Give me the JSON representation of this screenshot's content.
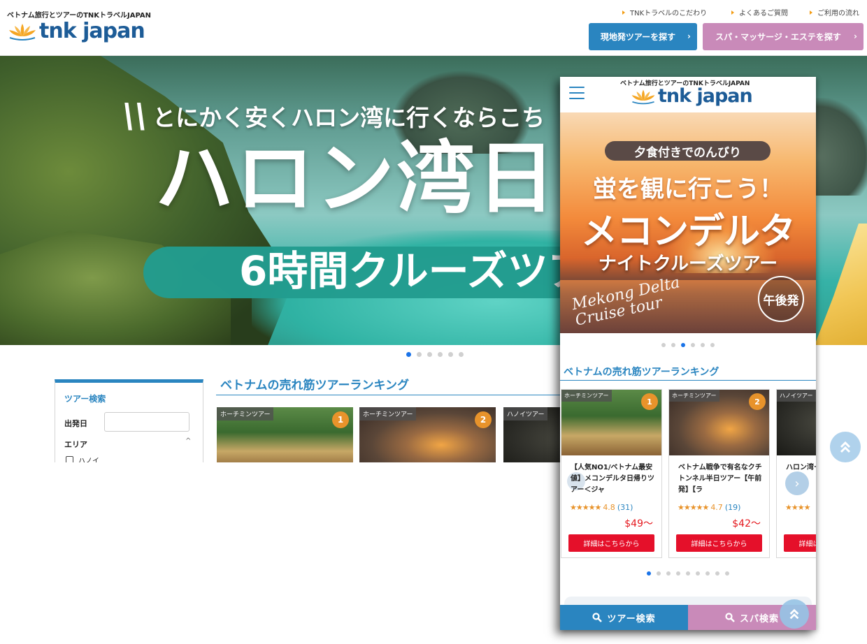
{
  "desktop": {
    "header": {
      "tagline": "ベトナム旅行とツアーのTNKトラベルJAPAN",
      "logo_text": "tnk japan",
      "top_links": [
        "TNKトラベルのこだわり",
        "よくあるご質問",
        "ご利用の流れ"
      ],
      "button_local_tour": "現地発ツアーを探す",
      "button_spa": "スパ・マッサージ・エステを探す"
    },
    "hero": {
      "subtitle": "とにかく安くハロン湾に行くならこち",
      "title": "ハロン湾日",
      "pill_text": "6時間クルーズツア",
      "slides_total": 6,
      "active_slide": 1
    },
    "search": {
      "title": "ツアー検索",
      "date_label": "出発日",
      "date_value": "",
      "area_label": "エリア",
      "area_options": [
        "ハノイ"
      ]
    },
    "ranking": {
      "title": "ベトナムの売れ筋ツアーランキング",
      "cards": [
        {
          "tag": "ホーチミンツアー",
          "rank": "1"
        },
        {
          "tag": "ホーチミンツアー",
          "rank": "2"
        },
        {
          "tag": "ハノイツアー",
          "rank": ""
        }
      ]
    },
    "back_to_top_icon": "double-chevron-up-icon"
  },
  "mobile": {
    "header": {
      "tagline": "ベトナム旅行とツアーのTNKトラベルJAPAN",
      "logo_text": "tnk japan",
      "menu_icon": "hamburger-icon"
    },
    "banner": {
      "pill": "夕食付きでのんびり",
      "line1": "蛍を観に行こう！",
      "line2": "メコンデルタ",
      "line3": "ナイトクルーズツアー",
      "script": "Mekong Delta\nCruise tour",
      "badge": "午後発",
      "slides_total": 6,
      "active_slide": 3
    },
    "ranking": {
      "title": "ベトナムの売れ筋ツアーランキング",
      "cards": [
        {
          "tag": "ホーチミンツアー",
          "rank": "1",
          "title": "【人気NO1/ベトナム最安値】メコンデルタ日帰りツアー＜ジャ",
          "stars": "★★★★★",
          "score": "4.8",
          "count": "(31)",
          "price": "$49〜",
          "detail": "詳細はこちらから"
        },
        {
          "tag": "ホーチミンツアー",
          "rank": "2",
          "title": "ベトナム戦争で有名なクチトンネル半日ツアー【午前発】【ラ",
          "stars": "★★★★★",
          "score": "4.7",
          "count": "(19)",
          "price": "$42〜",
          "detail": "詳細はこちらから"
        },
        {
          "tag": "ハノイツアー",
          "rank": "",
          "title": "ハロン湾ー",
          "stars": "★★★★",
          "score": "",
          "count": "",
          "price": "",
          "detail": "詳細はこちらから"
        }
      ],
      "slides_total": 9,
      "active_slide": 1,
      "next_icon": "chevron-right-icon"
    },
    "footer": {
      "tour_search": "ツアー検索",
      "spa_search": "スパ検索",
      "search_icon": "search-icon"
    },
    "back_to_top_icon": "double-chevron-up-icon"
  },
  "colors": {
    "brand_blue": "#2a85c0",
    "spa_pink": "#c98ab9",
    "rank_orange": "#e8932b",
    "price_red": "#e5191f",
    "detail_button_red": "#e5102a"
  }
}
